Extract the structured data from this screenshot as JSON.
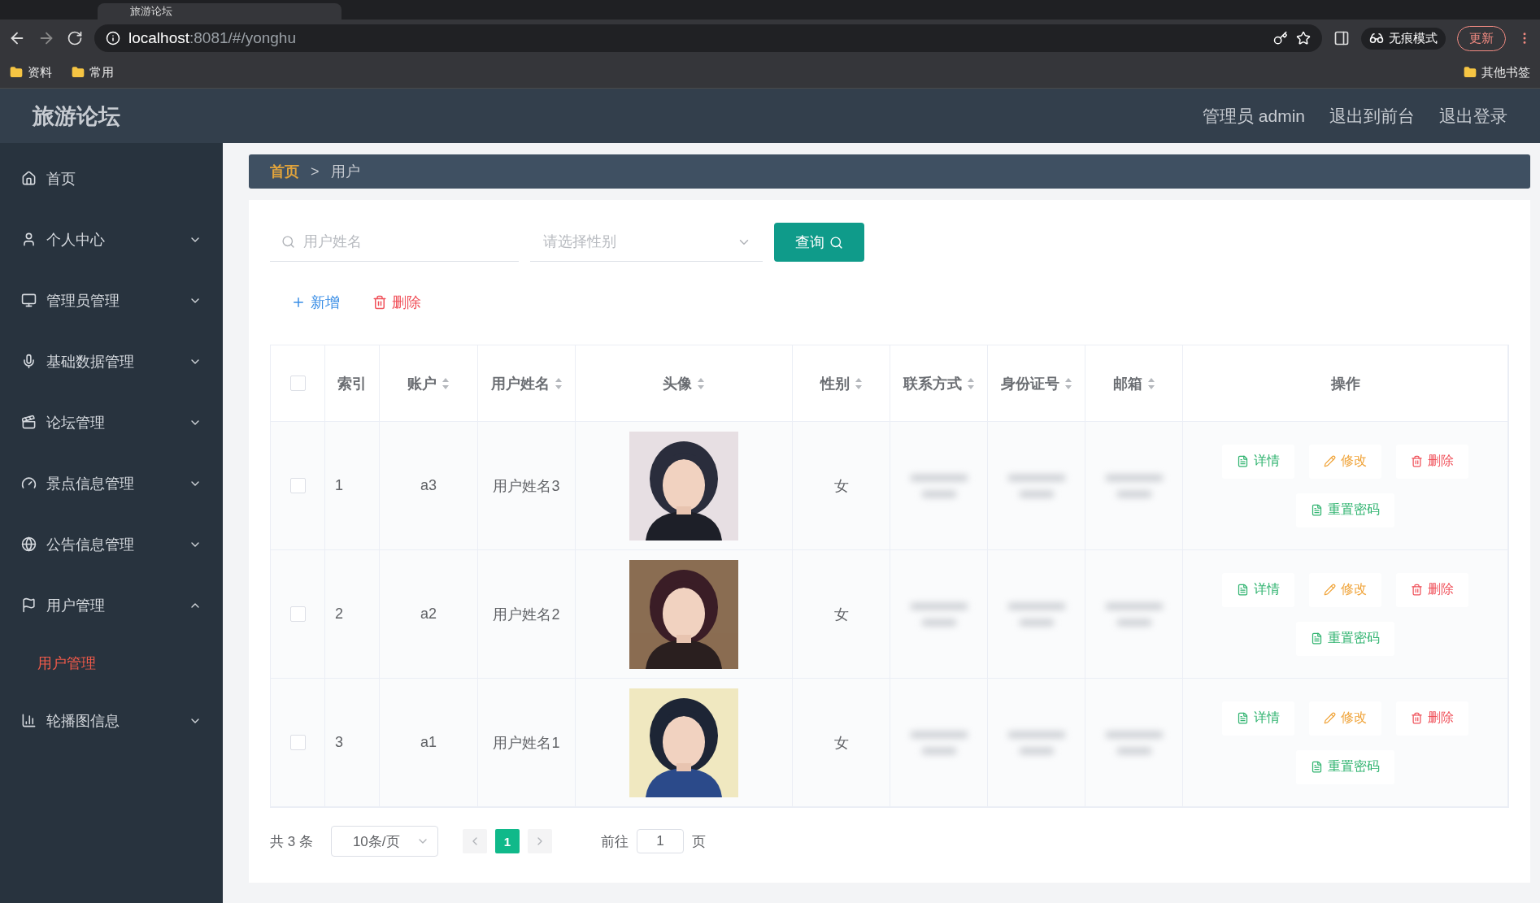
{
  "browser": {
    "tab_title": "旅游论坛",
    "url_host": "localhost",
    "url_rest": ":8081/#/yonghu",
    "profile_label": "无痕模式",
    "update_button": "更新",
    "bookmarks": [
      "资料",
      "常用"
    ],
    "other_bookmarks": "其他书签"
  },
  "header": {
    "title": "旅游论坛",
    "links": [
      "管理员 admin",
      "退出到前台",
      "退出登录"
    ]
  },
  "sidebar": {
    "items": [
      {
        "label": "首页",
        "expandable": false
      },
      {
        "label": "个人中心",
        "expandable": true,
        "expanded": false
      },
      {
        "label": "管理员管理",
        "expandable": true,
        "expanded": false
      },
      {
        "label": "基础数据管理",
        "expandable": true,
        "expanded": false
      },
      {
        "label": "论坛管理",
        "expandable": true,
        "expanded": false
      },
      {
        "label": "景点信息管理",
        "expandable": true,
        "expanded": false
      },
      {
        "label": "公告信息管理",
        "expandable": true,
        "expanded": false
      },
      {
        "label": "用户管理",
        "expandable": true,
        "expanded": true,
        "children": [
          {
            "label": "用户管理",
            "selected": true
          }
        ]
      },
      {
        "label": "轮播图信息",
        "expandable": true,
        "expanded": false
      }
    ]
  },
  "breadcrumb": {
    "items": [
      {
        "label": "首页",
        "selected": false
      },
      {
        "label": "用户",
        "selected": true
      }
    ],
    "separator": ">"
  },
  "search": {
    "name_placeholder": "用户姓名",
    "gender_placeholder": "请选择性别",
    "button": "查询"
  },
  "actions": [
    {
      "kind": "add",
      "label": "新增"
    },
    {
      "kind": "delete",
      "label": "删除"
    }
  ],
  "table": {
    "select_all_checked": false,
    "columns": [
      {
        "label": "索引",
        "sortable": false
      },
      {
        "label": "账户",
        "sortable": true
      },
      {
        "label": "用户姓名",
        "sortable": true
      },
      {
        "label": "头像",
        "sortable": true
      },
      {
        "label": "性别",
        "sortable": true
      },
      {
        "label": "联系方式",
        "sortable": true
      },
      {
        "label": "身份证号",
        "sortable": true
      },
      {
        "label": "邮箱",
        "sortable": true
      },
      {
        "label": "操作",
        "sortable": false
      }
    ],
    "rows": [
      {
        "checked": false,
        "index": "1",
        "account": "a3",
        "name": "用户姓名3",
        "gender": "女",
        "actions": [
          {
            "kind": "detail",
            "label": "详情"
          },
          {
            "kind": "edit",
            "label": "修改"
          },
          {
            "kind": "delete",
            "label": "删除"
          },
          {
            "kind": "reset",
            "label": "重置密码"
          }
        ]
      },
      {
        "checked": false,
        "index": "2",
        "account": "a2",
        "name": "用户姓名2",
        "gender": "女",
        "actions": [
          {
            "kind": "detail",
            "label": "详情"
          },
          {
            "kind": "edit",
            "label": "修改"
          },
          {
            "kind": "delete",
            "label": "删除"
          },
          {
            "kind": "reset",
            "label": "重置密码"
          }
        ]
      },
      {
        "checked": false,
        "index": "3",
        "account": "a1",
        "name": "用户姓名1",
        "gender": "女",
        "actions": [
          {
            "kind": "detail",
            "label": "详情"
          },
          {
            "kind": "edit",
            "label": "修改"
          },
          {
            "kind": "delete",
            "label": "删除"
          },
          {
            "kind": "reset",
            "label": "重置密码"
          }
        ]
      }
    ]
  },
  "pagination": {
    "total": "共 3 条",
    "page_size": "10条/页",
    "pages": [
      {
        "label": "1",
        "selected": true
      }
    ],
    "goto_label": "前往",
    "goto_value": "1",
    "page_unit": "页"
  }
}
